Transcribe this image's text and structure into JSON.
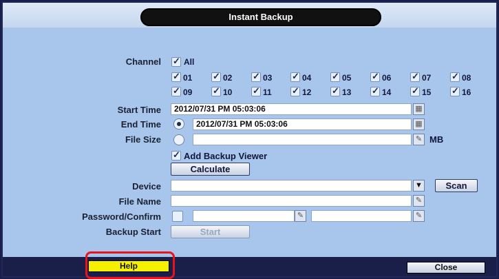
{
  "title": "Instant Backup",
  "labels": {
    "channel": "Channel",
    "start_time": "Start Time",
    "end_time": "End Time",
    "file_size": "File Size",
    "device": "Device",
    "file_name": "File Name",
    "password_confirm": "Password/Confirm",
    "backup_start": "Backup Start"
  },
  "channel": {
    "all_label": "All",
    "all_checked": true,
    "channels": [
      "01",
      "02",
      "03",
      "04",
      "05",
      "06",
      "07",
      "08",
      "09",
      "10",
      "11",
      "12",
      "13",
      "14",
      "15",
      "16"
    ]
  },
  "start_time": {
    "value": "2012/07/31 PM 05:03:06",
    "icon": "calendar-icon"
  },
  "end_time": {
    "value": "2012/07/31 PM 05:03:06",
    "selected": true,
    "icon": "calendar-icon"
  },
  "file_size": {
    "value": "",
    "unit": "MB",
    "selected": false,
    "icon": "pencil-icon"
  },
  "add_backup_viewer": {
    "label": "Add Backup Viewer",
    "checked": true
  },
  "buttons": {
    "calculate": "Calculate",
    "scan": "Scan",
    "start": "Start",
    "help": "Help",
    "close": "Close"
  },
  "device": {
    "value": "",
    "icon": "dropdown-arrow-icon"
  },
  "file_name": {
    "value": "",
    "icon": "pencil-icon"
  },
  "password": {
    "checked": false,
    "password_value": "",
    "confirm_value": ""
  },
  "colors": {
    "dialog_bg": "#a8c6ec",
    "footer_bg": "#1a1f4a",
    "help_button": "#f5f000",
    "highlight": "#e8141b"
  }
}
